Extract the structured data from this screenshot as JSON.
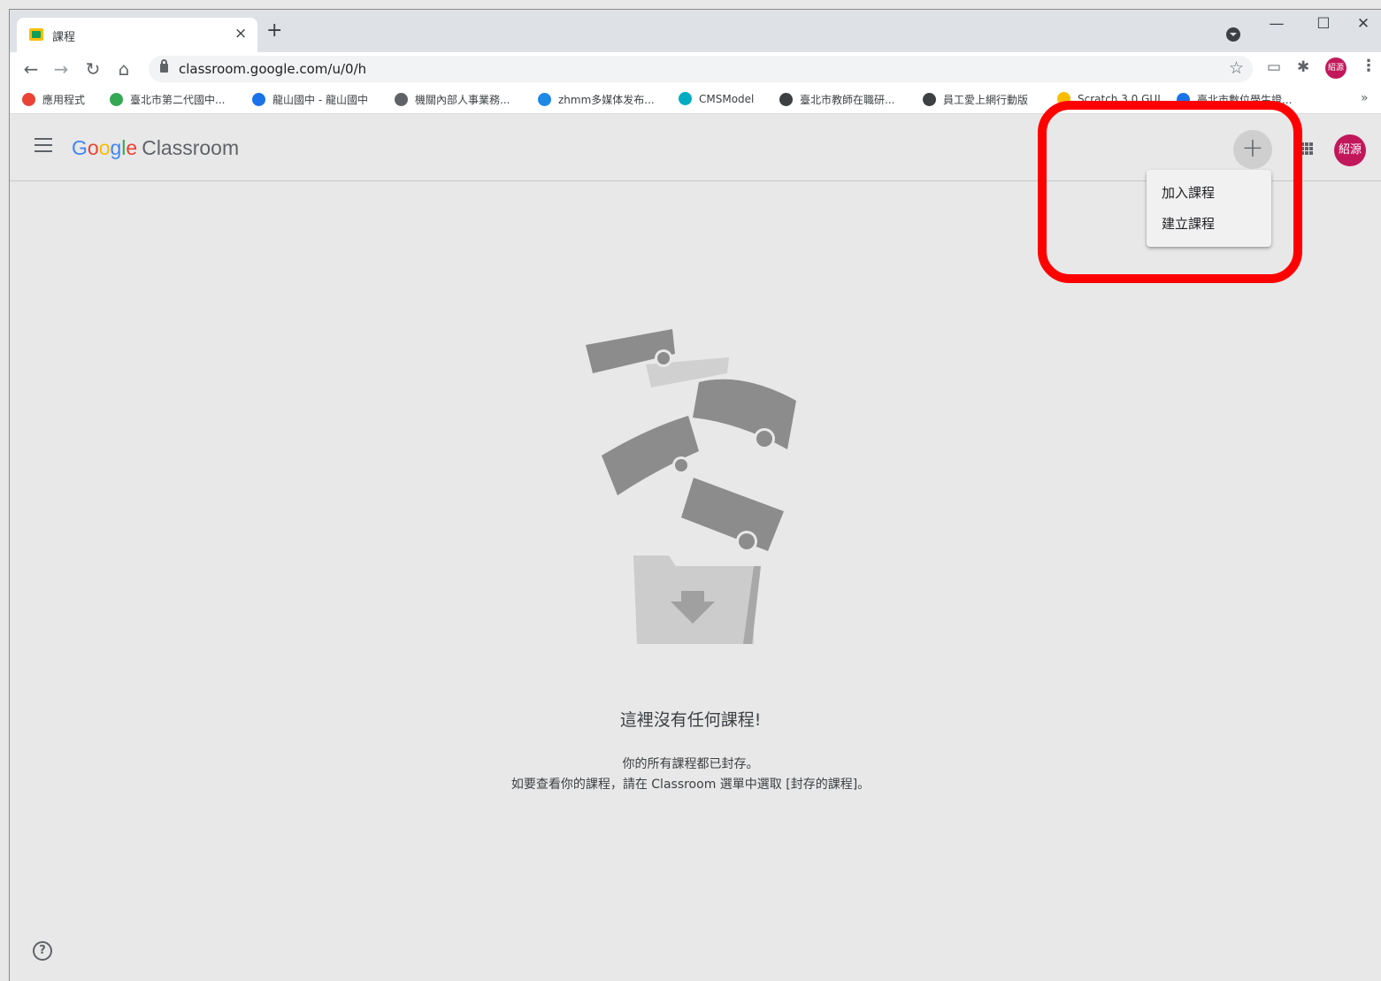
{
  "browser": {
    "tab_title": "課程",
    "tab_close": "×",
    "new_tab": "+",
    "window_minimize": "—",
    "window_maximize": "☐",
    "window_close": "✕",
    "url": "classroom.google.com/u/0/h",
    "profile_initials": "紹源",
    "bookmarks": [
      {
        "label": "應用程式",
        "color": "#ea4335"
      },
      {
        "label": "臺北市第二代國中...",
        "color": "#34a853"
      },
      {
        "label": "龍山國中 - 龍山國中",
        "color": "#1a73e8"
      },
      {
        "label": "機關內部人事業務...",
        "color": "#5f6368"
      },
      {
        "label": "zhmm多媒体发布...",
        "color": "#1e88e5"
      },
      {
        "label": "CMSModel",
        "color": "#00acc1"
      },
      {
        "label": "臺北市教師在職研...",
        "color": "#3c4043"
      },
      {
        "label": "員工愛上網行動版",
        "color": "#3c4043"
      },
      {
        "label": "Scratch 3.0 GUI",
        "color": "#fbbc04"
      },
      {
        "label": "臺北市數位學生證...",
        "color": "#1a73e8"
      }
    ],
    "bookmarks_more": "»"
  },
  "app": {
    "logo_google": [
      "G",
      "o",
      "o",
      "g",
      "l",
      "e"
    ],
    "logo_product": "Classroom",
    "add_button": "+",
    "avatar_initials": "紹源",
    "menu": {
      "join_class": "加入課程",
      "create_class": "建立課程"
    },
    "empty_state": {
      "title": "這裡沒有任何課程!",
      "line1": "你的所有課程都已封存。",
      "line2": "如要查看你的課程，請在 Classroom 選單中選取 [封存的課程]。"
    },
    "help": "?"
  },
  "colors": {
    "highlight": "#ff0000",
    "avatar": "#c2185b",
    "background": "#e8e8e8"
  }
}
